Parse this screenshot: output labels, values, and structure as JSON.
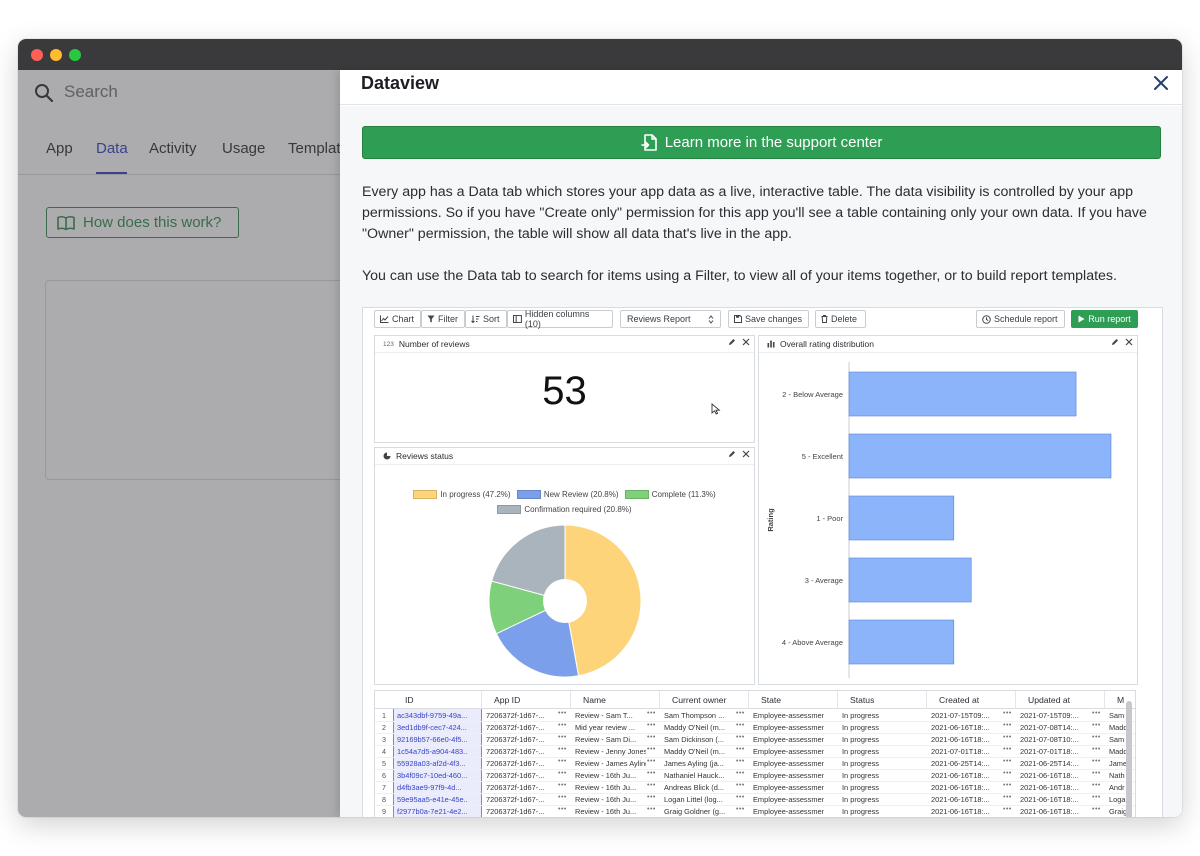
{
  "app": {
    "search_placeholder": "Search",
    "tabs": [
      "App",
      "Data",
      "Activity",
      "Usage",
      "Templat"
    ],
    "how_button": "How does this work?"
  },
  "panel": {
    "title": "Dataview",
    "support_button": "Learn more in the support center",
    "paragraph1": "Every app has a Data tab which stores your app data as a live, interactive table. The data visibility is controlled by your app permissions. So if you have \"Create only\" permission for this app you'll see a table containing only your own data. If you have \"Owner\" permission, the table will show all data that's live in the app.",
    "paragraph2": "You can use the Data tab to search for items using a Filter, to view all of your items together, or to build report templates."
  },
  "report": {
    "toolbar": {
      "chart": "Chart",
      "filter": "Filter",
      "sort": "Sort",
      "hidden_columns": "Hidden columns (10)",
      "report_select": "Reviews Report",
      "save_changes": "Save changes",
      "delete": "Delete",
      "schedule_report": "Schedule report",
      "run_report": "Run report"
    },
    "widget_number": {
      "badge": "123",
      "title": "Number of reviews",
      "value": "53"
    },
    "widget_status": {
      "title": "Reviews status",
      "legend": [
        {
          "label": "In progress (47.2%)",
          "color": "#fdd47a"
        },
        {
          "label": "New Review (20.8%)",
          "color": "#7b9fea"
        },
        {
          "label": "Complete (11.3%)",
          "color": "#7ed07a"
        },
        {
          "label": "Confirmation required (20.8%)",
          "color": "#a9b4bd"
        }
      ]
    },
    "widget_rating": {
      "title": "Overall rating distribution",
      "y_axis_label": "Rating"
    },
    "table": {
      "columns": [
        "ID",
        "App ID",
        "Name",
        "Current owner",
        "State",
        "Status",
        "Created at",
        "Updated at",
        "M"
      ],
      "rows": [
        [
          "ac343dbf-9759-49a...",
          "7206372f-1d67-...",
          "Review - Sam T...",
          "Sam Thompson ...",
          "Employee-assessment",
          "In progress",
          "2021-07-15T09:...",
          "2021-07-15T09:...",
          "Sam"
        ],
        [
          "3ed1db9f-cec7-424...",
          "7206372f-1d67-...",
          "Mid year review ...",
          "Maddy O'Neil (m...",
          "Employee-assessment",
          "In progress",
          "2021-06-16T18:...",
          "2021-07-08T14:...",
          "Madd"
        ],
        [
          "92169b57-66e0-4f5...",
          "7206372f-1d67-...",
          "Review - Sam Di...",
          "Sam Dickinson (...",
          "Employee-assessment",
          "In progress",
          "2021-06-16T18:...",
          "2021-07-08T10:...",
          "Sam"
        ],
        [
          "1c54a7d5-a904-483...",
          "7206372f-1d67-...",
          "Review - Jenny Jones",
          "Maddy O'Neil (m...",
          "Employee-assessment",
          "In progress",
          "2021-07-01T18:...",
          "2021-07-01T18:...",
          "Madd"
        ],
        [
          "55928a03-af2d-4f3...",
          "7206372f-1d67-...",
          "Review - James Ayling",
          "James Ayling (ja...",
          "Employee-assessment",
          "In progress",
          "2021-06-25T14:...",
          "2021-06-25T14:...",
          "Jame"
        ],
        [
          "3b4f09c7-10ed-460...",
          "7206372f-1d67-...",
          "Review - 16th Ju...",
          "Nathaniel Hauck...",
          "Employee-assessment",
          "In progress",
          "2021-06-16T18:...",
          "2021-06-16T18:...",
          "Nath"
        ],
        [
          "d4fb3ae9-97f9-4d...",
          "7206372f-1d67-...",
          "Review - 16th Ju...",
          "Andreas Blick (d...",
          "Employee-assessment",
          "In progress",
          "2021-06-16T18:...",
          "2021-06-16T18:...",
          "Andr"
        ],
        [
          "59e95aa5-e41e-45e...",
          "7206372f-1d67-...",
          "Review - 16th Ju...",
          "Logan Littel (log...",
          "Employee-assessment",
          "In progress",
          "2021-06-16T18:...",
          "2021-06-16T18:...",
          "Loga"
        ],
        [
          "f2977b0a-7e21-4e2...",
          "7206372f-1d67-...",
          "Review - 16th Ju...",
          "Graig Goldner (g...",
          "Employee-assessment",
          "In progress",
          "2021-06-16T18:...",
          "2021-06-16T18:...",
          "Graig"
        ]
      ]
    }
  },
  "chart_data": [
    {
      "type": "pie",
      "title": "Reviews status",
      "categories": [
        "In progress",
        "New Review",
        "Complete",
        "Confirmation required"
      ],
      "values": [
        47.2,
        20.8,
        11.3,
        20.8
      ],
      "colors": [
        "#fdd47a",
        "#7b9fea",
        "#7ed07a",
        "#a9b4bd"
      ],
      "donut": true,
      "legend": "top"
    },
    {
      "type": "bar",
      "orientation": "horizontal",
      "title": "Overall rating distribution",
      "ylabel": "Rating",
      "categories": [
        "2 - Below Average",
        "5 - Excellent",
        "1 - Poor",
        "3 - Average",
        "4 - Above Average"
      ],
      "values": [
        13,
        15,
        6,
        7,
        6
      ],
      "color": "#8cb4fa",
      "xlim": [
        0,
        15
      ],
      "grid": false
    }
  ]
}
